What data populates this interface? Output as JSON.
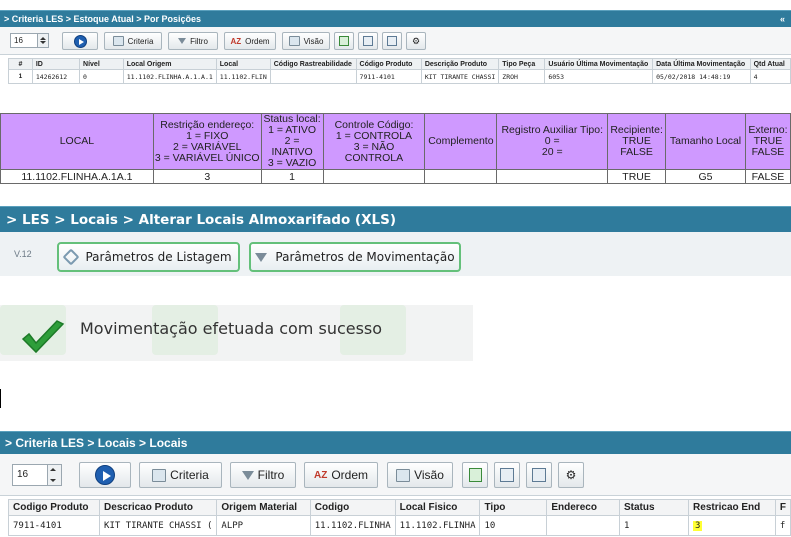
{
  "panel1": {
    "breadcrumb": "> Criteria LES > Estoque Atual > Por Posições",
    "corner_glyph": "«",
    "page_size": "16",
    "buttons": {
      "criteria": "Criteria",
      "filtro": "Filtro",
      "ordem": "Ordem",
      "visao": "Visão"
    },
    "columns": [
      "#",
      "ID",
      "Nível",
      "Local Origem",
      "Local",
      "Código Rastreabilidade",
      "Código Produto",
      "Descrição Produto",
      "Tipo Peça",
      "Usuário Última Movimentação",
      "Data Última Movimentação",
      "Qtd Atual"
    ],
    "rows": [
      [
        "1",
        "14262612",
        "0",
        "11.1102.FLINHA.A.1.A.1",
        "11.1102.FLIN",
        "",
        "7911-4101",
        "KIT TIRANTE CHASSI",
        "ZROH",
        "6053",
        "05/02/2018 14:48:19",
        "4"
      ]
    ]
  },
  "sheet": {
    "headers": [
      [
        "LOCAL"
      ],
      [
        "Restrição endereço:",
        "1 = FIXO",
        "2 = VARIÁVEL",
        "3 = VARIÁVEL ÚNICO"
      ],
      [
        "Status local:",
        "1 = ATIVO",
        "2 = INATIVO",
        "3 = VAZIO"
      ],
      [
        "Controle Código:",
        "1 = CONTROLA",
        "3 = NÃO CONTROLA"
      ],
      [
        "Complemento"
      ],
      [
        "Registro Auxiliar Tipo:",
        "0 =",
        "20 ="
      ],
      [
        "Recipiente:",
        "TRUE",
        "FALSE"
      ],
      [
        "Tamanho Local"
      ],
      [
        "Externo:",
        "TRUE",
        "FALSE"
      ]
    ],
    "row": [
      "11.1102.FLINHA.A.1A.1",
      "3",
      "1",
      "",
      "",
      "",
      "TRUE",
      "G5",
      "FALSE"
    ]
  },
  "panel3": {
    "breadcrumb": "> LES > Locais > Alterar Locais Almoxarifado (XLS)",
    "version": "V.12",
    "btn_listagem": "Parâmetros de Listagem",
    "btn_movimentacao": "Parâmetros de Movimentação"
  },
  "toast": {
    "message": "Movimentação efetuada com sucesso",
    "accent": "#2e9e3a"
  },
  "panel5": {
    "breadcrumb": "> Criteria LES > Locais > Locais",
    "page_size": "16",
    "buttons": {
      "criteria": "Criteria",
      "filtro": "Filtro",
      "ordem": "Ordem",
      "visao": "Visão"
    },
    "columns": [
      "Codigo Produto",
      "Descricao Produto",
      "Origem Material",
      "Codigo",
      "Local Fisico",
      "Tipo",
      "Endereco",
      "Status",
      "Restricao End",
      "F"
    ],
    "rows": [
      [
        "7911-4101",
        "KIT TIRANTE CHASSI (",
        "ALPP",
        "11.1102.FLINHA",
        "11.1102.FLINHA",
        "10",
        "",
        "1",
        "3",
        "f"
      ]
    ]
  },
  "colors": {
    "title_bar": "#2f7b9c",
    "sheet_header": "#cf99ff",
    "highlight": "#ffff33",
    "button_border": "#64c07a"
  }
}
